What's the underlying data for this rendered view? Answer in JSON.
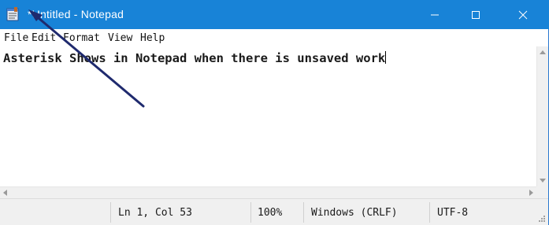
{
  "window": {
    "title": "*Untitled - Notepad",
    "controls": {
      "minimize_icon": "minimize-icon",
      "maximize_icon": "maximize-icon",
      "close_icon": "close-icon"
    }
  },
  "menu": {
    "items": [
      {
        "label": "File"
      },
      {
        "label": "Edit"
      },
      {
        "label": "Format"
      },
      {
        "label": "View"
      },
      {
        "label": "Help"
      }
    ]
  },
  "editor": {
    "content": "Asterisk Shows in Notepad when there is unsaved work"
  },
  "statusbar": {
    "position": "Ln 1, Col 53",
    "zoom": "100%",
    "line_ending": "Windows (CRLF)",
    "encoding": "UTF-8"
  },
  "colors": {
    "titlebar": "#1883d7",
    "annotation_arrow": "#1f2a6e"
  }
}
